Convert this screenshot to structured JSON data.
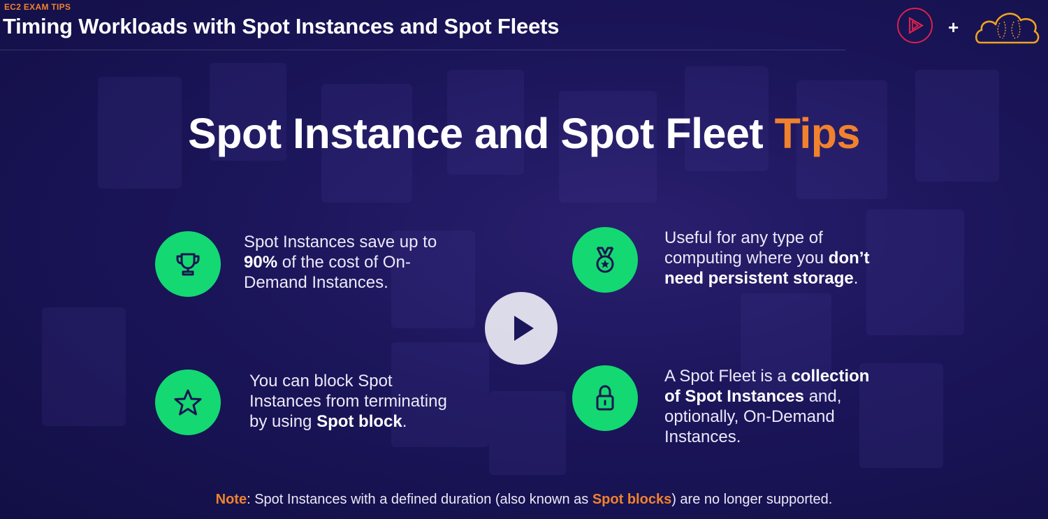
{
  "header": {
    "kicker": "EC2 EXAM TIPS",
    "title": "Timing Workloads with Spot Instances and Spot Fleets",
    "plus": "+"
  },
  "headline": {
    "main": "Spot Instance and Spot Fleet",
    "accent": "Tips"
  },
  "tips": [
    {
      "icon": "trophy-icon",
      "lines": [
        [
          "Spot Instances save up to",
          ""
        ],
        [
          "",
          "90%",
          " of the cost of On-"
        ],
        [
          "Demand Instances.",
          ""
        ]
      ]
    },
    {
      "icon": "medal-icon",
      "lines": [
        [
          "Useful for any type of",
          ""
        ],
        [
          "computing where you ",
          "don’t",
          ""
        ],
        [
          "",
          "need persistent storage",
          "."
        ]
      ]
    },
    {
      "icon": "star-icon",
      "lines": [
        [
          "You can block Spot",
          ""
        ],
        [
          "Instances from terminating",
          ""
        ],
        [
          "by using ",
          "Spot block",
          "."
        ]
      ]
    },
    {
      "icon": "lock-icon",
      "lines": [
        [
          "A Spot Fleet is a ",
          "collection",
          ""
        ],
        [
          "",
          "of Spot Instances",
          " and,"
        ],
        [
          "optionally, On-Demand",
          ""
        ],
        [
          "Instances.",
          ""
        ]
      ]
    }
  ],
  "note": {
    "label": "Note",
    "text_before": ": Spot Instances with a defined duration (also known as ",
    "highlight": "Spot blocks",
    "text_after": ") are no longer supported."
  },
  "colors": {
    "accent_orange": "#f0822e",
    "icon_green": "#14d872",
    "background": "#1b155a",
    "brand_red": "#d9224c"
  },
  "player": {
    "play_icon": "play-icon"
  }
}
